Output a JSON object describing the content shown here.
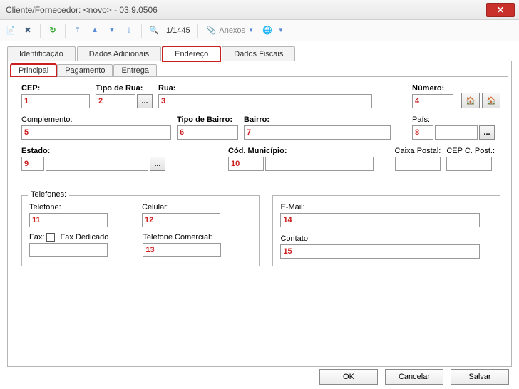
{
  "window": {
    "title": "Cliente/Fornecedor: <novo> - 03.9.0506"
  },
  "toolbar": {
    "counter": "1/1445",
    "anexos_label": "Anexos"
  },
  "tabs": {
    "identificacao": "Identificação",
    "dados_adicionais": "Dados Adicionais",
    "endereco": "Endereço",
    "dados_fiscais": "Dados Fiscais"
  },
  "subtabs": {
    "principal": "Principal",
    "pagamento": "Pagamento",
    "entrega": "Entrega"
  },
  "labels": {
    "cep": "CEP:",
    "tipo_rua": "Tipo de Rua:",
    "rua": "Rua:",
    "numero": "Número:",
    "complemento": "Complemento:",
    "tipo_bairro": "Tipo de Bairro:",
    "bairro": "Bairro:",
    "pais": "País:",
    "estado": "Estado:",
    "cod_municipio": "Cód. Município:",
    "caixa_postal": "Caixa Postal:",
    "cep_c_post": "CEP C. Post.:",
    "telefones": "Telefones:",
    "telefone": "Telefone:",
    "celular": "Celular:",
    "fax": "Fax:",
    "fax_dedicado": "Fax Dedicado",
    "telefone_comercial": "Telefone Comercial:",
    "email": "E-Mail:",
    "contato": "Contato:"
  },
  "values": {
    "cep": "1",
    "tipo_rua": "2",
    "rua": "3",
    "numero": "4",
    "complemento": "5",
    "tipo_bairro": "6",
    "bairro": "7",
    "pais": "8",
    "estado": "9",
    "cod_municipio": "10",
    "telefone": "11",
    "celular": "12",
    "telefone_comercial": "13",
    "email": "14",
    "contato": "15"
  },
  "buttons": {
    "ok": "OK",
    "cancelar": "Cancelar",
    "salvar": "Salvar",
    "ellipsis": "..."
  }
}
